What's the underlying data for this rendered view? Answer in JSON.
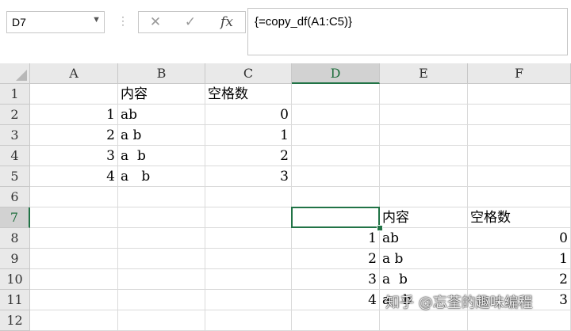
{
  "name_box": {
    "value": "D7",
    "dropdown_icon": "chevron-down-icon"
  },
  "formula_bar": {
    "separator": "⋮",
    "cancel_glyph": "✕",
    "enter_glyph": "✓",
    "fx_glyph": "fx",
    "formula": "{=copy_df(A1:C5)}"
  },
  "columns": [
    "A",
    "B",
    "C",
    "D",
    "E",
    "F"
  ],
  "rows": [
    "1",
    "2",
    "3",
    "4",
    "5",
    "6",
    "7",
    "8",
    "9",
    "10",
    "11",
    "12"
  ],
  "cells": {
    "B1": "内容",
    "C1": "空格数",
    "A2": "1",
    "B2": "ab",
    "C2": "0",
    "A3": "2",
    "B3": "a b",
    "C3": "1",
    "A4": "3",
    "B4": "a  b",
    "C4": "2",
    "A5": "4",
    "B5": "a   b",
    "C5": "3",
    "E7": "内容",
    "F7": "空格数",
    "D8": "1",
    "E8": "ab",
    "F8": "0",
    "D9": "2",
    "E9": "a b",
    "F9": "1",
    "D10": "3",
    "E10": "a  b",
    "F10": "2",
    "D11": "4",
    "E11": "a   b",
    "F11": "3"
  },
  "selected_cell": "D7",
  "selected_column": "D",
  "selected_row": "7",
  "colors": {
    "accent": "#217346",
    "header_bg": "#e9e9e9",
    "gridline": "#dadada"
  },
  "watermark": "知乎 @忘荃的趣味编程"
}
